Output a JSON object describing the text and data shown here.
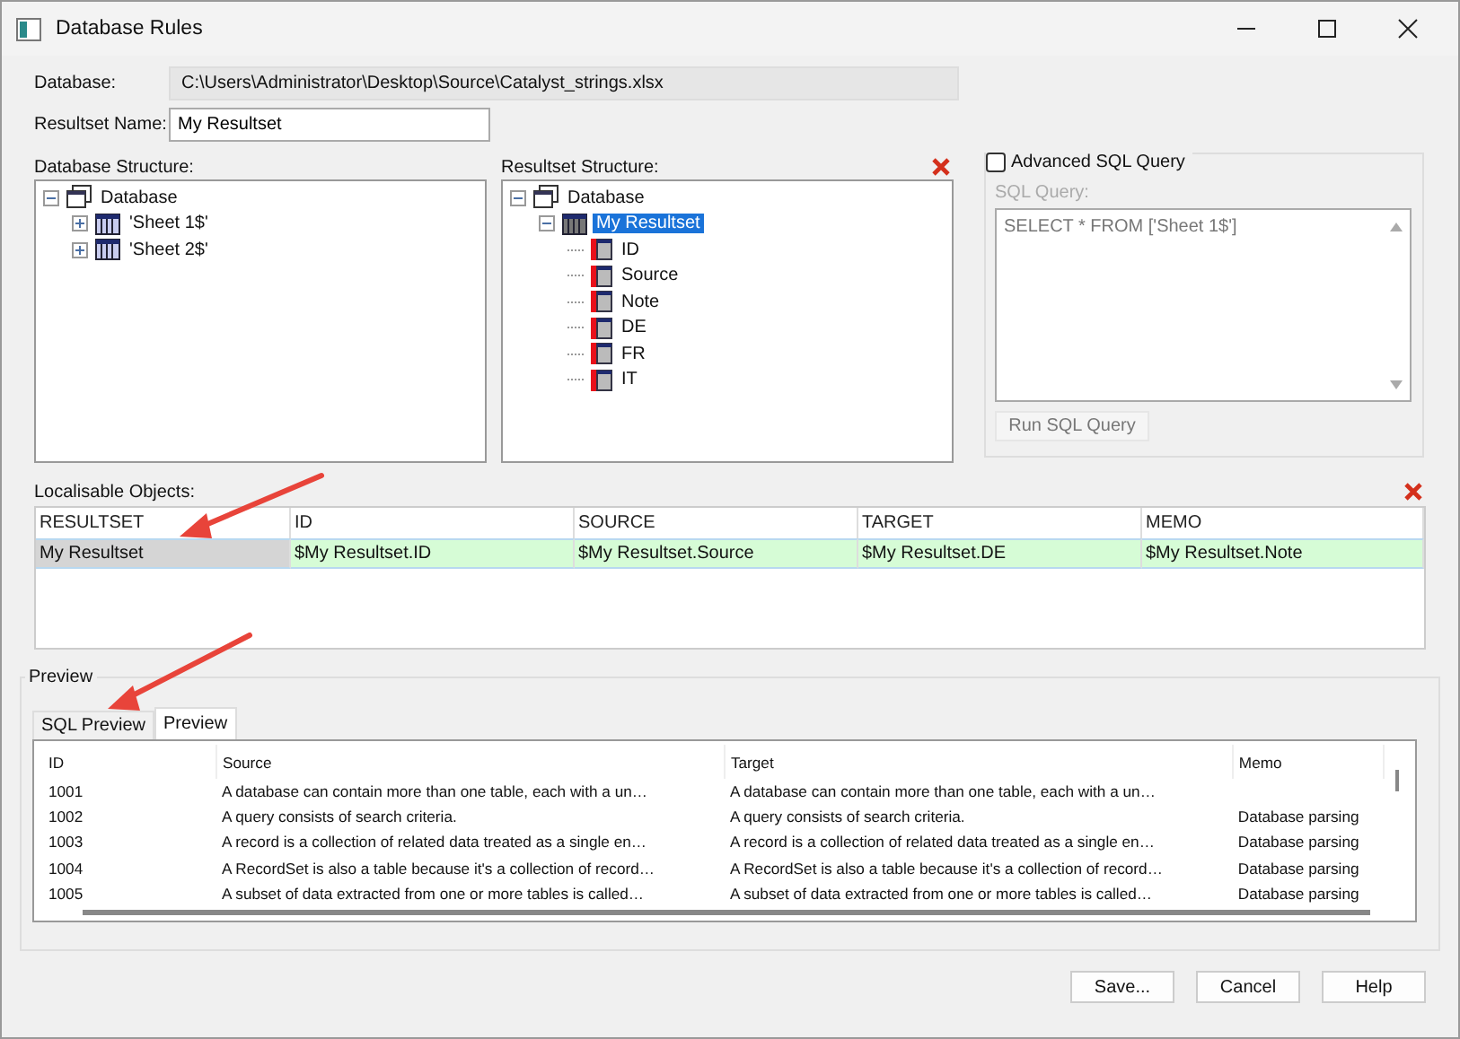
{
  "window": {
    "title": "Database Rules"
  },
  "database": {
    "label": "Database:",
    "value": "C:\\Users\\Administrator\\Desktop\\Source\\Catalyst_strings.xlsx"
  },
  "resultset_name": {
    "label": "Resultset Name:",
    "value": "My Resultset"
  },
  "database_structure": {
    "label": "Database Structure:",
    "tree": [
      {
        "label": "Database",
        "kind": "database",
        "expanded": true,
        "selected": false,
        "children": [
          {
            "label": "'Sheet 1$'",
            "kind": "table",
            "expanded": false,
            "selected": false
          },
          {
            "label": "'Sheet 2$'",
            "kind": "table",
            "expanded": false,
            "selected": false
          }
        ]
      }
    ]
  },
  "resultset_structure": {
    "label": "Resultset Structure:",
    "tree": [
      {
        "label": "Database",
        "kind": "database",
        "expanded": true,
        "selected": false,
        "children": [
          {
            "label": "My Resultset",
            "kind": "resultset",
            "expanded": true,
            "selected": true,
            "children": [
              {
                "label": "ID",
                "kind": "field",
                "selected": false
              },
              {
                "label": "Source",
                "kind": "field",
                "selected": false
              },
              {
                "label": "Note",
                "kind": "field",
                "selected": false
              },
              {
                "label": "DE",
                "kind": "field",
                "selected": false
              },
              {
                "label": "FR",
                "kind": "field",
                "selected": false
              },
              {
                "label": "IT",
                "kind": "field",
                "selected": false
              }
            ]
          }
        ]
      }
    ]
  },
  "advanced_sql": {
    "label": "Advanced SQL Query",
    "checked": false,
    "disabled": true,
    "query_label": "SQL Query:",
    "query": "SELECT * FROM ['Sheet 1$']",
    "run_button": "Run SQL Query"
  },
  "localisable_objects": {
    "label": "Localisable Objects:",
    "columns": [
      "RESULTSET",
      "ID",
      "SOURCE",
      "TARGET",
      "MEMO"
    ],
    "rows": [
      {
        "selected": true,
        "cells": [
          "My Resultset",
          "$My Resultset.ID",
          "$My Resultset.Source",
          "$My Resultset.DE",
          "$My Resultset.Note"
        ]
      }
    ]
  },
  "preview": {
    "label": "Preview",
    "tabs": [
      {
        "label": "SQL Preview",
        "selected": false
      },
      {
        "label": "Preview",
        "selected": true
      }
    ],
    "columns": [
      "ID",
      "Source",
      "Target",
      "Memo"
    ],
    "rows": [
      [
        "1001",
        "A database can contain more than one table, each with a un…",
        "A database can contain more than one table, each with a un…",
        ""
      ],
      [
        "1002",
        "A query consists of search criteria.",
        "A query consists of search criteria.",
        "Database parsing"
      ],
      [
        "1003",
        "A record is a collection of related data treated as a single en…",
        "A record is a collection of related data treated as a single en…",
        "Database parsing"
      ],
      [
        "1004",
        "A RecordSet is also a table because it's a collection of record…",
        "A RecordSet is also a table because it's a collection of record…",
        "Database parsing"
      ],
      [
        "1005",
        "A subset of data extracted from one or more tables is called…",
        "A subset of data extracted from one or more tables is called…",
        "Database parsing"
      ]
    ]
  },
  "buttons": [
    "Save...",
    "Cancel",
    "Help"
  ]
}
